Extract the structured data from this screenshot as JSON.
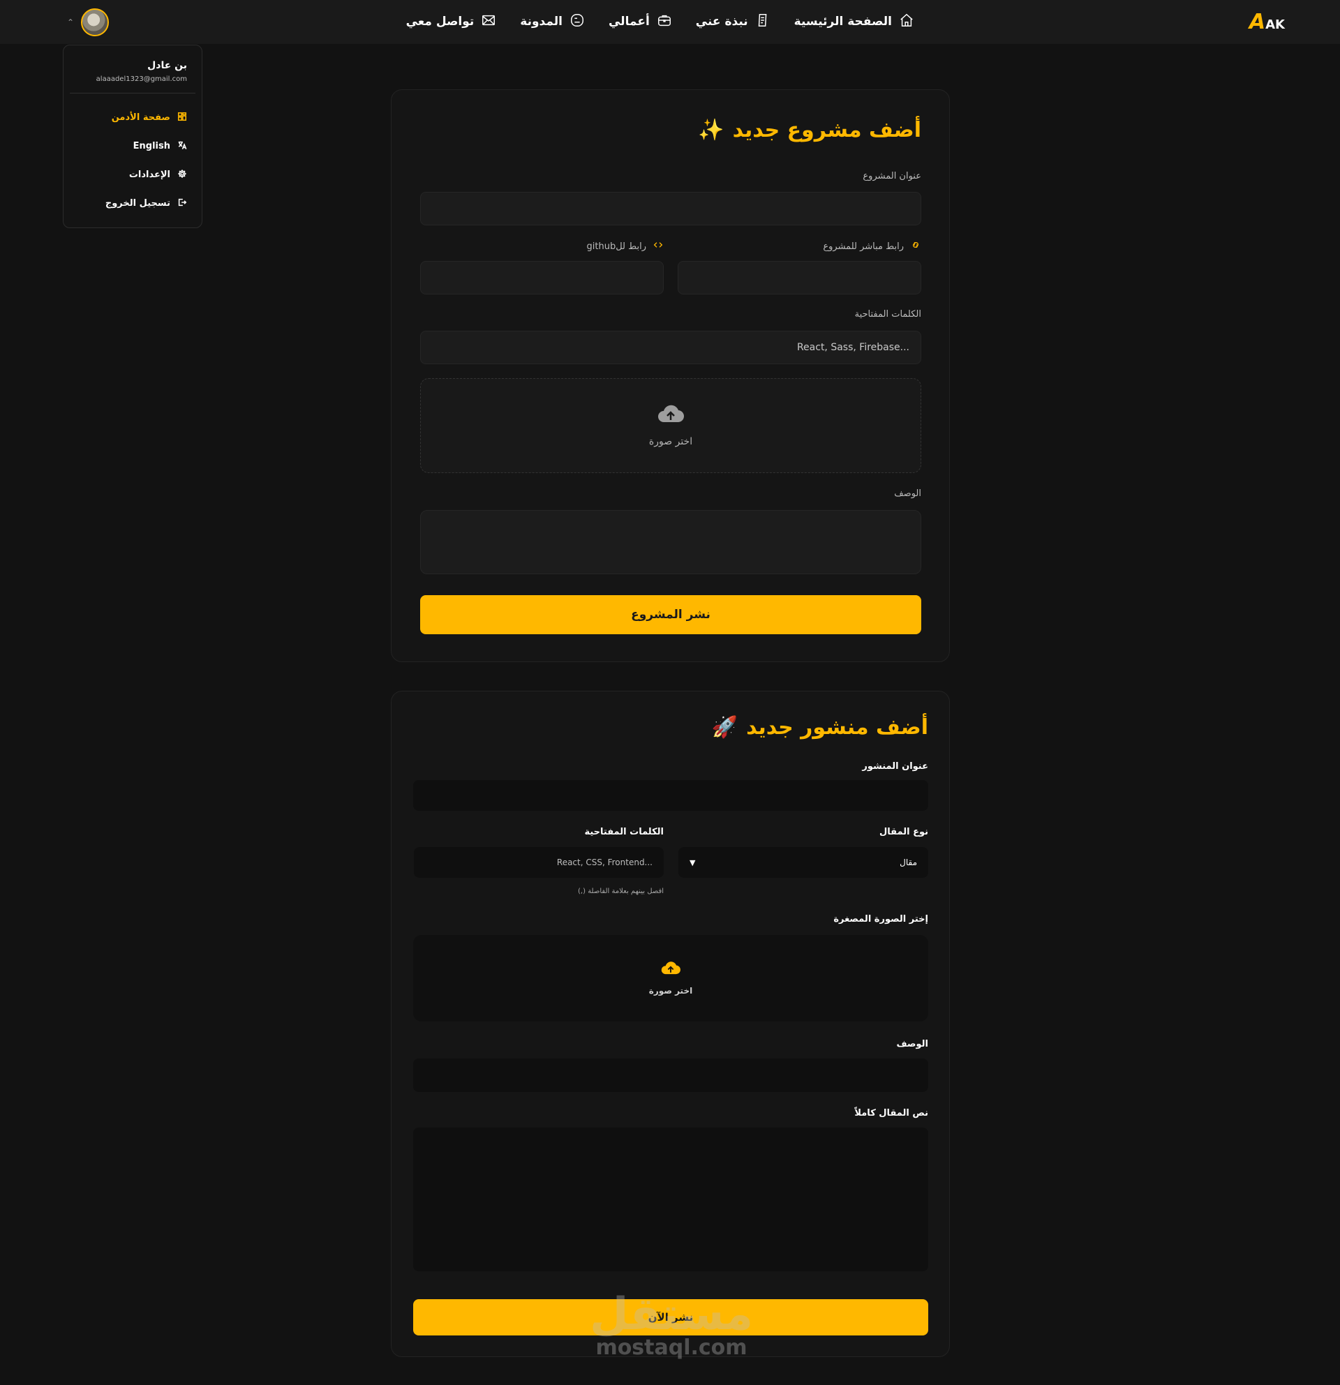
{
  "logo": {
    "letter": "A",
    "rest": "AK"
  },
  "nav": {
    "items": [
      {
        "label": "الصفحة الرئيسية",
        "icon": "home-icon"
      },
      {
        "label": "نبذة عني",
        "icon": "document-icon"
      },
      {
        "label": "أعمالي",
        "icon": "briefcase-icon"
      },
      {
        "label": "المدونة",
        "icon": "blog-icon"
      },
      {
        "label": "تواصل معي",
        "icon": "mail-icon"
      }
    ]
  },
  "user_menu": {
    "name": "بن عادل",
    "email": "alaaadel1323@gmail.com",
    "items": [
      {
        "label": "صفحة الأدمن",
        "icon": "dashboard-icon",
        "active": true
      },
      {
        "label": "English",
        "icon": "translate-icon"
      },
      {
        "label": "الإعدادات",
        "icon": "gear-icon"
      },
      {
        "label": "تسجيل الخروج",
        "icon": "logout-icon"
      }
    ]
  },
  "project_form": {
    "title": "أضف مشروع جديد",
    "title_emoji": "✨",
    "title_label": "عنوان المشروع",
    "live_link_label": "رابط مباشر للمشروع",
    "github_label": "رابط لل‎github",
    "keywords_label": "الكلمات المفتاحية",
    "keywords_placeholder": "React, Sass, Firebase...",
    "upload_label": "اختر صورة",
    "description_label": "الوصف",
    "submit_label": "نشر المشروع"
  },
  "post_form": {
    "title": "أضف منشور جديد",
    "title_emoji": "🚀",
    "title_label": "عنوان المنشور",
    "type_label": "نوع المقال",
    "type_selected": "مقال",
    "keywords_label": "الكلمات المفتاحية",
    "keywords_placeholder": "React, CSS, Frontend...",
    "keywords_hint": "افصل بينهم بعلامة الفاصلة (,)",
    "thumbnail_label": "إختر الصورة المصغرة",
    "upload_label": "اختر صورة",
    "description_label": "الوصف",
    "body_label": "نص المقال كاملاً",
    "submit_label": "نشر الآن"
  },
  "watermark": {
    "arabic": "مستقل",
    "latin": "mostaql.com"
  },
  "colors": {
    "accent": "#ffb800",
    "background": "#121212",
    "card": "#151515",
    "navbar": "#1a1a1a"
  }
}
